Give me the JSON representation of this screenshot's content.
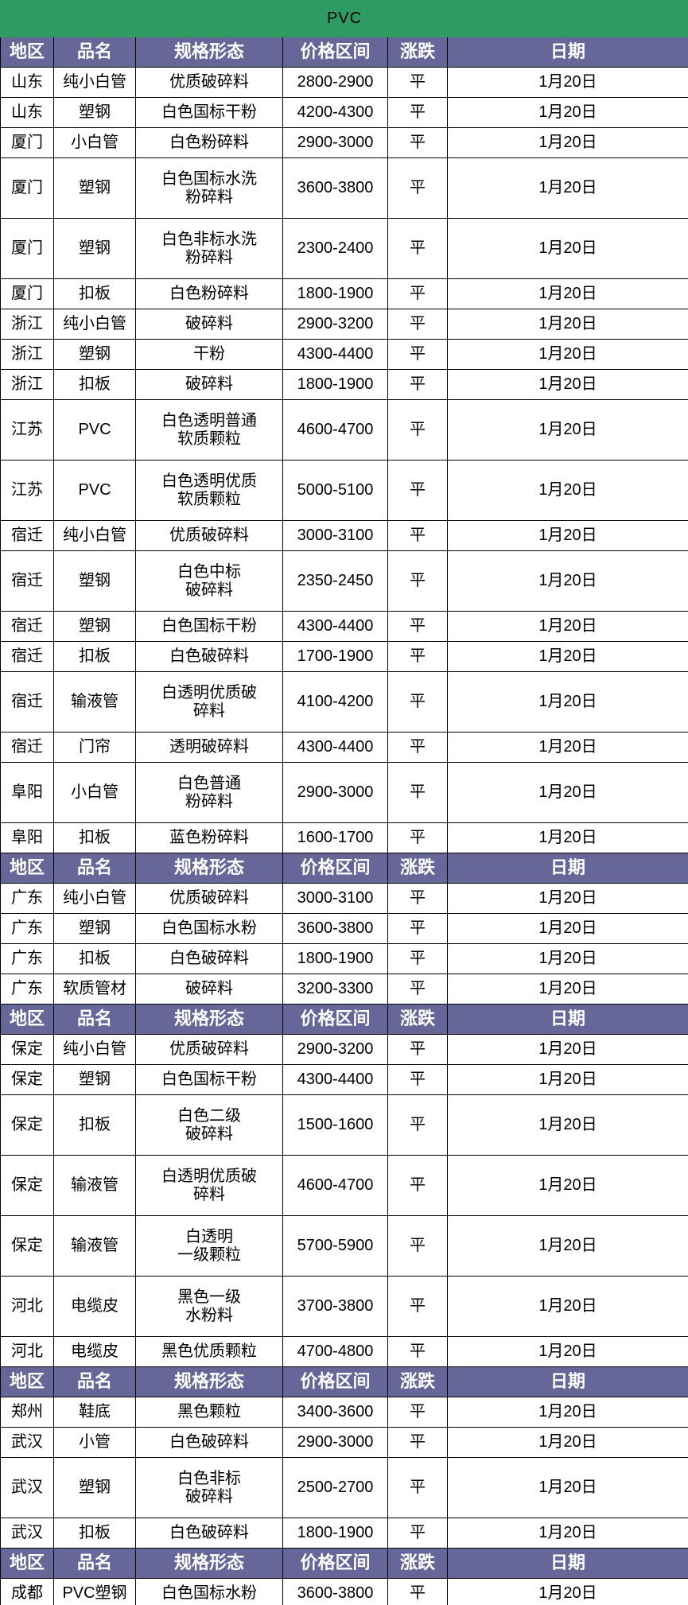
{
  "title": "PVC",
  "header": {
    "region": "地区",
    "product": "品名",
    "spec": "规格形态",
    "price": "价格区间",
    "change": "涨跌",
    "date": "日期"
  },
  "colors": {
    "title_bg": "#2E9B63",
    "header_bg": "#666699",
    "date_text": "#FF0000",
    "grid_line": "#000000"
  },
  "sections": [
    {
      "rows": [
        {
          "region": "山东",
          "product": "纯小白管",
          "spec": "优质破碎料",
          "price": "2800-2900",
          "change": "平",
          "date": "1月20日",
          "tall": false
        },
        {
          "region": "山东",
          "product": "塑钢",
          "spec": "白色国标干粉",
          "price": "4200-4300",
          "change": "平",
          "date": "1月20日",
          "tall": false
        },
        {
          "region": "厦门",
          "product": "小白管",
          "spec": "白色粉碎料",
          "price": "2900-3000",
          "change": "平",
          "date": "1月20日",
          "tall": false
        },
        {
          "region": "厦门",
          "product": "塑钢",
          "spec": "白色国标水洗\n粉碎料",
          "price": "3600-3800",
          "change": "平",
          "date": "1月20日",
          "tall": true
        },
        {
          "region": "厦门",
          "product": "塑钢",
          "spec": "白色非标水洗\n粉碎料",
          "price": "2300-2400",
          "change": "平",
          "date": "1月20日",
          "tall": true
        },
        {
          "region": "厦门",
          "product": "扣板",
          "spec": "白色粉碎料",
          "price": "1800-1900",
          "change": "平",
          "date": "1月20日",
          "tall": false
        },
        {
          "region": "浙江",
          "product": "纯小白管",
          "spec": "破碎料",
          "price": "2900-3200",
          "change": "平",
          "date": "1月20日",
          "tall": false
        },
        {
          "region": "浙江",
          "product": "塑钢",
          "spec": "干粉",
          "price": "4300-4400",
          "change": "平",
          "date": "1月20日",
          "tall": false
        },
        {
          "region": "浙江",
          "product": "扣板",
          "spec": "破碎料",
          "price": "1800-1900",
          "change": "平",
          "date": "1月20日",
          "tall": false
        },
        {
          "region": "江苏",
          "product": "PVC",
          "spec": "白色透明普通\n软质颗粒",
          "price": "4600-4700",
          "change": "平",
          "date": "1月20日",
          "tall": true
        },
        {
          "region": "江苏",
          "product": "PVC",
          "spec": "白色透明优质\n软质颗粒",
          "price": "5000-5100",
          "change": "平",
          "date": "1月20日",
          "tall": true
        },
        {
          "region": "宿迁",
          "product": "纯小白管",
          "spec": "优质破碎料",
          "price": "3000-3100",
          "change": "平",
          "date": "1月20日",
          "tall": false
        },
        {
          "region": "宿迁",
          "product": "塑钢",
          "spec": "白色中标\n破碎料",
          "price": "2350-2450",
          "change": "平",
          "date": "1月20日",
          "tall": true
        },
        {
          "region": "宿迁",
          "product": "塑钢",
          "spec": "白色国标干粉",
          "price": "4300-4400",
          "change": "平",
          "date": "1月20日",
          "tall": false
        },
        {
          "region": "宿迁",
          "product": "扣板",
          "spec": "白色破碎料",
          "price": "1700-1900",
          "change": "平",
          "date": "1月20日",
          "tall": false
        },
        {
          "region": "宿迁",
          "product": "输液管",
          "spec": "白透明优质破\n碎料",
          "price": "4100-4200",
          "change": "平",
          "date": "1月20日",
          "tall": true
        },
        {
          "region": "宿迁",
          "product": "门帘",
          "spec": "透明破碎料",
          "price": "4300-4400",
          "change": "平",
          "date": "1月20日",
          "tall": false
        },
        {
          "region": "阜阳",
          "product": "小白管",
          "spec": "白色普通\n粉碎料",
          "price": "2900-3000",
          "change": "平",
          "date": "1月20日",
          "tall": true
        },
        {
          "region": "阜阳",
          "product": "扣板",
          "spec": "蓝色粉碎料",
          "price": "1600-1700",
          "change": "平",
          "date": "1月20日",
          "tall": false
        }
      ]
    },
    {
      "rows": [
        {
          "region": "广东",
          "product": "纯小白管",
          "spec": "优质破碎料",
          "price": "3000-3100",
          "change": "平",
          "date": "1月20日",
          "tall": false
        },
        {
          "region": "广东",
          "product": "塑钢",
          "spec": "白色国标水粉",
          "price": "3600-3800",
          "change": "平",
          "date": "1月20日",
          "tall": false
        },
        {
          "region": "广东",
          "product": "扣板",
          "spec": "白色破碎料",
          "price": "1800-1900",
          "change": "平",
          "date": "1月20日",
          "tall": false
        },
        {
          "region": "广东",
          "product": "软质管材",
          "spec": "破碎料",
          "price": "3200-3300",
          "change": "平",
          "date": "1月20日",
          "tall": false
        }
      ]
    },
    {
      "rows": [
        {
          "region": "保定",
          "product": "纯小白管",
          "spec": "优质破碎料",
          "price": "2900-3200",
          "change": "平",
          "date": "1月20日",
          "tall": false
        },
        {
          "region": "保定",
          "product": "塑钢",
          "spec": "白色国标干粉",
          "price": "4300-4400",
          "change": "平",
          "date": "1月20日",
          "tall": false
        },
        {
          "region": "保定",
          "product": "扣板",
          "spec": "白色二级\n破碎料",
          "price": "1500-1600",
          "change": "平",
          "date": "1月20日",
          "tall": true
        },
        {
          "region": "保定",
          "product": "输液管",
          "spec": "白透明优质破\n碎料",
          "price": "4600-4700",
          "change": "平",
          "date": "1月20日",
          "tall": true
        },
        {
          "region": "保定",
          "product": "输液管",
          "spec": "白透明\n一级颗粒",
          "price": "5700-5900",
          "change": "平",
          "date": "1月20日",
          "tall": true
        },
        {
          "region": "河北",
          "product": "电缆皮",
          "spec": "黑色一级\n水粉料",
          "price": "3700-3800",
          "change": "平",
          "date": "1月20日",
          "tall": true
        },
        {
          "region": "河北",
          "product": "电缆皮",
          "spec": "黑色优质颗粒",
          "price": "4700-4800",
          "change": "平",
          "date": "1月20日",
          "tall": false
        }
      ]
    },
    {
      "rows": [
        {
          "region": "郑州",
          "product": "鞋底",
          "spec": "黑色颗粒",
          "price": "3400-3600",
          "change": "平",
          "date": "1月20日",
          "tall": false
        },
        {
          "region": "武汉",
          "product": "小管",
          "spec": "白色破碎料",
          "price": "2900-3000",
          "change": "平",
          "date": "1月20日",
          "tall": false
        },
        {
          "region": "武汉",
          "product": "塑钢",
          "spec": "白色非标\n破碎料",
          "price": "2500-2700",
          "change": "平",
          "date": "1月20日",
          "tall": true
        },
        {
          "region": "武汉",
          "product": "扣板",
          "spec": "白色破碎料",
          "price": "1800-1900",
          "change": "平",
          "date": "1月20日",
          "tall": false
        }
      ]
    },
    {
      "rows": [
        {
          "region": "成都",
          "product": "PVC塑钢",
          "spec": "白色国标水粉",
          "price": "3600-3800",
          "change": "平",
          "date": "1月20日",
          "tall": false
        }
      ]
    }
  ]
}
